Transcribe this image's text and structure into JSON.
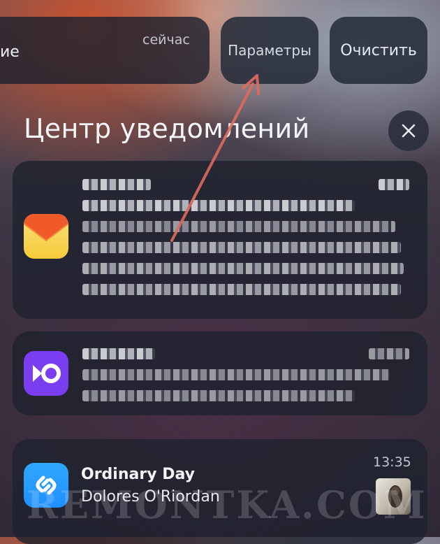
{
  "top_notification": {
    "text_fragment": "ие",
    "time": "сейчас"
  },
  "actions": {
    "options_label": "Параметры",
    "clear_label": "Очистить"
  },
  "notification_center": {
    "title": "Центр уведомлений"
  },
  "notifications": [
    {
      "app": "mail-app",
      "redacted": true
    },
    {
      "app": "yoomoney-app",
      "redacted": true
    },
    {
      "app": "shazam-app",
      "title": "Ordinary Day",
      "subtitle": "Dolores O'Riordan",
      "time": "13:35"
    }
  ],
  "watermark": {
    "text": "REMONTKA.COM"
  },
  "colors": {
    "arrow": "#e06a5e",
    "mail_yellow": "#f6c93a",
    "mail_orange": "#f05a2a",
    "yoomoney_purple": "#7a3df0",
    "shazam_blue": "#1f8fff"
  }
}
